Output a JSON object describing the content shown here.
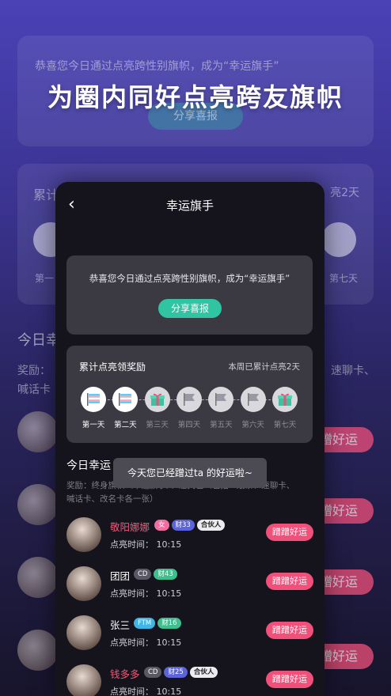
{
  "background": {
    "banner_text": "恭喜您今日通过点亮跨性别旗帜，成为“幸运旗手”",
    "share_label": "分享喜报",
    "stats_left": "累计",
    "stats_right": "亮2天",
    "day_first": "第一",
    "day_last": "第七天",
    "today_label": "今日幸运",
    "reward_line1": "奖励：",
    "reward_line2_right": "速聊卡、",
    "reward_line3": "喊话卡",
    "gift_label": "赠好运"
  },
  "headline": "为圈内同好点亮跨友旗帜",
  "app": {
    "title": "幸运旗手",
    "congrats": "恭喜您今日通过点亮跨性别旗帜，成为“幸运旗手”",
    "share_button": "分享喜报",
    "rewards_card_title": "累计点亮领奖励",
    "weekly_status": "本周已累计点亮2天",
    "days": [
      {
        "label": "第一天",
        "icon": "trans-flag-icon",
        "done": true
      },
      {
        "label": "第二天",
        "icon": "trans-flag-icon",
        "done": true
      },
      {
        "label": "第三天",
        "icon": "gift-box-icon",
        "done": false
      },
      {
        "label": "第四天",
        "icon": "flag-icon",
        "done": false
      },
      {
        "label": "第五天",
        "icon": "flag-icon",
        "done": false
      },
      {
        "label": "第六天",
        "icon": "flag-icon",
        "done": false
      },
      {
        "label": "第七天",
        "icon": "gift-box-icon",
        "done": false
      }
    ],
    "section_title": "今日幸运",
    "rewards_text_1": "奖励：终身旗帜（幸运旗手）、道具包（包括 d纸条、速聊卡、",
    "rewards_text_2": "喊话卡、改名卡各一张）",
    "toast": "今天您已经蹭过ta 的好运啦~",
    "time_prefix": "点亮时间：",
    "gift_button": "蹭蹭好运",
    "users": [
      {
        "name": "敬阳娜娜",
        "name_color": "#f05a7a",
        "badges": [
          "女",
          "财33",
          "合伙人"
        ],
        "time": "10:15"
      },
      {
        "name": "团团",
        "name_color": "#ffffff",
        "badges": [
          "CD",
          "财43"
        ],
        "time": "10:15"
      },
      {
        "name": "张三",
        "name_color": "#ffffff",
        "badges": [
          "FTM",
          "财16"
        ],
        "time": "10:15"
      },
      {
        "name": "钱多多",
        "name_color": "#f05a7a",
        "badges": [
          "CD",
          "财25",
          "合伙人"
        ],
        "time": "10:15"
      }
    ]
  },
  "colors": {
    "accent_green": "#2fc4a2",
    "accent_pink": "#f0507a",
    "card": "#3b3942"
  }
}
